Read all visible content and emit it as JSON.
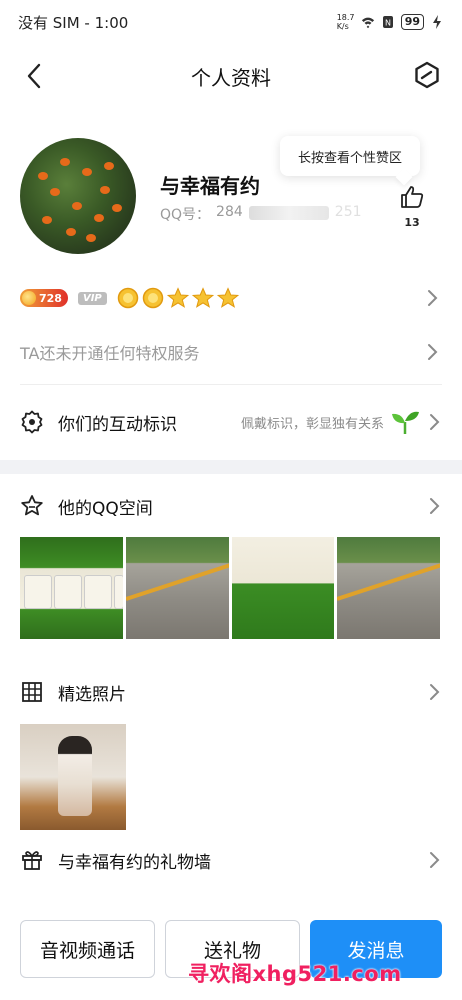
{
  "status_bar": {
    "carrier_time": "没有 SIM - 1:00",
    "net_speed": "18.7 K/s",
    "battery": "99"
  },
  "header": {
    "title": "个人资料"
  },
  "profile": {
    "name": "与幸福有约",
    "qq_label": "QQ号：",
    "qq_number_visible": "284",
    "qq_number_tail": "251",
    "like_tooltip": "长按查看个性赞区",
    "like_count": "13"
  },
  "badges": {
    "level_value": "728",
    "vip_label": "VIP",
    "crowns": 2,
    "stars": 3
  },
  "privilege_text": "TA还未开通任何特权服务",
  "interaction": {
    "label": "你们的互动标识",
    "hint": "佩戴标识，彰显独有关系"
  },
  "qzone": {
    "label": "他的QQ空间"
  },
  "featured_photos": {
    "label": "精选照片"
  },
  "gift_wall": {
    "label": "与幸福有约的礼物墙"
  },
  "actions": {
    "video_call": "音视频通话",
    "send_gift": "送礼物",
    "send_message": "发消息"
  },
  "watermark": "寻欢阁xhg521.com",
  "colors": {
    "primary_blue": "#1e8ff7",
    "level_orange": "#e0302a",
    "watermark_pink": "#f02060",
    "section_gap": "#f1f2f5"
  }
}
